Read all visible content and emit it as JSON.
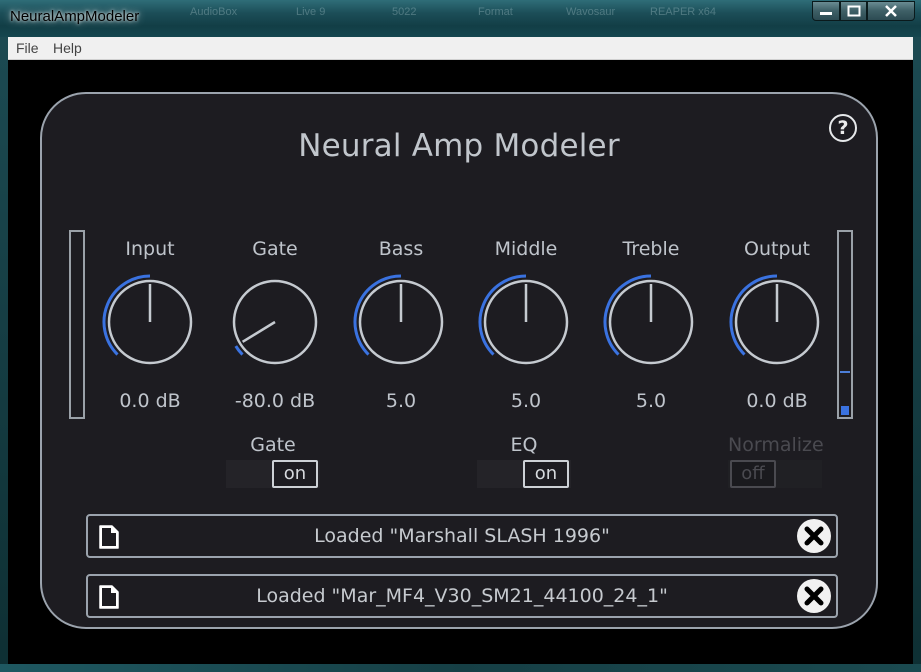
{
  "window": {
    "title": "NeuralAmpModeler",
    "min_glyph": "—",
    "max_glyph": "▢",
    "close_glyph": "✕"
  },
  "menu": [
    "File",
    "Help"
  ],
  "plugin": {
    "title": "Neural Amp Modeler",
    "help_glyph": "?",
    "accent_color": "#3a72e0",
    "knobs": [
      {
        "label": "Input",
        "value": "0.0 dB",
        "level": 0.5
      },
      {
        "label": "Gate",
        "value": "-80.0 dB",
        "level": 0.05
      },
      {
        "label": "Bass",
        "value": "5.0",
        "level": 0.5
      },
      {
        "label": "Middle",
        "value": "5.0",
        "level": 0.5
      },
      {
        "label": "Treble",
        "value": "5.0",
        "level": 0.5
      },
      {
        "label": "Output",
        "value": "0.0 dB",
        "level": 0.5
      }
    ],
    "switches": [
      {
        "label": "Gate",
        "state": "on",
        "enabled": true
      },
      {
        "label": "EQ",
        "state": "on",
        "enabled": true
      },
      {
        "label": "Normalize",
        "state": "off",
        "enabled": false
      }
    ],
    "meters": {
      "input_level": 0.0,
      "output_level": 0.05,
      "output_peak": 0.24
    },
    "loaders": [
      {
        "text": "Loaded \"Marshall SLASH 1996\""
      },
      {
        "text": "Loaded \"Mar_MF4_V30_SM21_44100_24_1\""
      }
    ],
    "icons": {
      "file": "file-icon",
      "clear": "close-x-icon",
      "help": "help-icon"
    }
  }
}
